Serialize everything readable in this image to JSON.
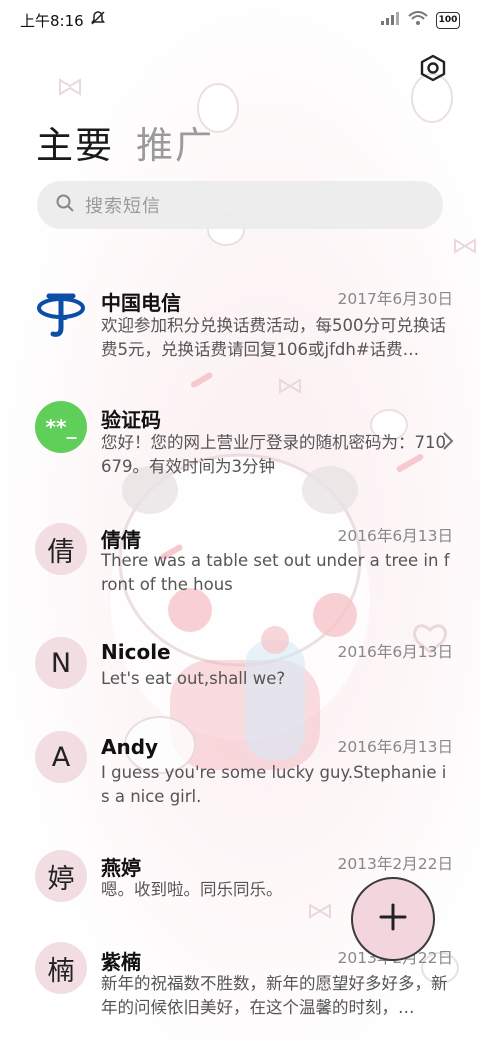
{
  "status_bar": {
    "time": "上午8:16",
    "battery": "100"
  },
  "tabs": [
    {
      "label": "主要",
      "active": true
    },
    {
      "label": "推广",
      "active": false
    }
  ],
  "search": {
    "placeholder": "搜索短信"
  },
  "conversations": [
    {
      "name": "中国电信",
      "date": "2017年6月30日",
      "preview": "欢迎参加积分兑换话费活动，每500分可兑换话费5元，兑换话费请回复106或jfdh#话费…",
      "avatar": "telecom-logo"
    },
    {
      "name": "验证码",
      "date": "",
      "preview": "您好！您的网上营业厅登录的随机密码为：710679。有效时间为3分钟",
      "avatar": "**_"
    },
    {
      "name": "倩倩",
      "date": "2016年6月13日",
      "preview": "There was a table set out under a tree in front of the hous",
      "avatar": "倩"
    },
    {
      "name": "Nicole",
      "date": "2016年6月13日",
      "preview": "Let's eat out,shall we?",
      "avatar": "N"
    },
    {
      "name": "Andy",
      "date": "2016年6月13日",
      "preview": "I guess you're some lucky guy.Stephanie is a nice girl.",
      "avatar": "A"
    },
    {
      "name": "燕婷",
      "date": "2013年2月22日",
      "preview": "嗯。收到啦。同乐同乐。",
      "avatar": "婷"
    },
    {
      "name": "紫楠",
      "date": "2013年2月22日",
      "preview": "新年的祝福数不胜数，新年的愿望好多好多，新年的问候依旧美好，在这个温馨的时刻，…",
      "avatar": "楠"
    }
  ],
  "colors": {
    "accent_fab": "#f3d5dd",
    "code_avatar": "#5fcf5a",
    "telecom_blue": "#0a4ea8",
    "letter_avatar": "#f2dde2"
  },
  "icons": [
    "mute-icon",
    "signal-icon",
    "wifi-icon",
    "battery-icon",
    "settings-hexagon-icon",
    "search-icon",
    "chevron-right-icon",
    "plus-icon"
  ]
}
